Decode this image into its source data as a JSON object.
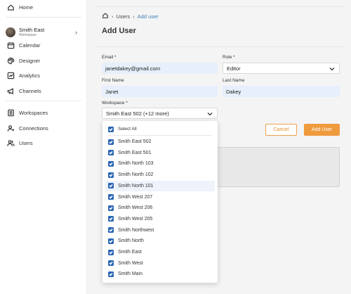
{
  "sidebar": {
    "home": "Home",
    "workspace": {
      "name": "Smith East",
      "subtitle": "Workspace"
    },
    "items": [
      {
        "label": "Calendar",
        "icon": "calendar-icon"
      },
      {
        "label": "Designer",
        "icon": "palette-icon"
      },
      {
        "label": "Analytics",
        "icon": "analytics-icon"
      },
      {
        "label": "Channels",
        "icon": "megaphone-icon"
      }
    ],
    "admin": [
      {
        "label": "Workspaces",
        "icon": "workspaces-icon"
      },
      {
        "label": "Connections",
        "icon": "connections-icon"
      },
      {
        "label": "Users",
        "icon": "users-icon"
      }
    ]
  },
  "breadcrumb": {
    "users": "Users",
    "current": "Add user"
  },
  "page": {
    "title": "Add User"
  },
  "form": {
    "email_label": "Email *",
    "email_value": "janetdakey@gmail.com",
    "role_label": "Role *",
    "role_value": "Editor",
    "first_label": "First Name",
    "first_value": "Janet",
    "last_label": "Last Name",
    "last_value": "Dakey",
    "workspace_label": "Workspace *",
    "workspace_value": "Smith East 502 (+12 more)"
  },
  "buttons": {
    "cancel": "Cancel",
    "add": "Add User"
  },
  "dropdown": {
    "select_all": "Select All",
    "options": [
      "Smith East 502",
      "Smith East 501",
      "Smith North 103",
      "Smith North 102",
      "Smith North 101",
      "Smith West 207",
      "Smith West 206",
      "Smith West 205",
      "Smith Northwest",
      "Smith North",
      "Smith East",
      "Smith West",
      "Smith Main"
    ]
  },
  "colors": {
    "accent": "#ef9a3c",
    "checkbox": "#2a66b4",
    "link": "#3f7fb6",
    "input_bg": "#e6effb"
  }
}
